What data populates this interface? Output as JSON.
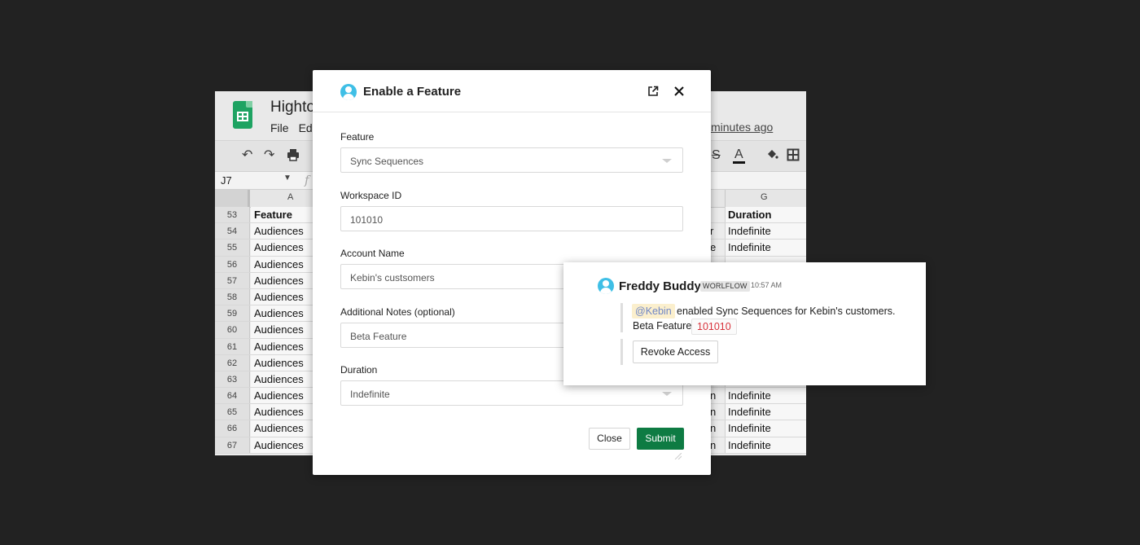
{
  "sheet": {
    "title": "Highto",
    "menu": [
      "File",
      "Ed"
    ],
    "last_edit": "minutes ago",
    "cell_ref": "J7",
    "fx": "f",
    "col_a": "A",
    "col_g": "G",
    "header_row": {
      "num": "53",
      "a": "Feature",
      "g": "Duration"
    },
    "rows": [
      {
        "num": "54",
        "a": "Audiences",
        "f": "r",
        "g": "Indefinite"
      },
      {
        "num": "55",
        "a": "Audiences",
        "f": "e",
        "g": "Indefinite"
      },
      {
        "num": "56",
        "a": "Audiences",
        "f": "",
        "g": ""
      },
      {
        "num": "57",
        "a": "Audiences",
        "f": "",
        "g": ""
      },
      {
        "num": "58",
        "a": "Audiences",
        "f": "",
        "g": ""
      },
      {
        "num": "59",
        "a": "Audiences",
        "f": "",
        "g": ""
      },
      {
        "num": "60",
        "a": "Audiences",
        "f": "",
        "g": ""
      },
      {
        "num": "61",
        "a": "Audiences",
        "f": "",
        "g": ""
      },
      {
        "num": "62",
        "a": "Audiences",
        "f": "",
        "g": ""
      },
      {
        "num": "63",
        "a": "Audiences",
        "f": "",
        "g": ""
      },
      {
        "num": "64",
        "a": "Audiences",
        "f": "n",
        "g": "Indefinite"
      },
      {
        "num": "65",
        "a": "Audiences",
        "f": "n",
        "g": "Indefinite"
      },
      {
        "num": "66",
        "a": "Audiences",
        "f": "n",
        "g": "Indefinite"
      },
      {
        "num": "67",
        "a": "Audiences",
        "f": "n",
        "g": "Indefinite"
      }
    ]
  },
  "modal": {
    "title": "Enable a Feature",
    "fields": {
      "feature": {
        "label": "Feature",
        "value": "Sync Sequences"
      },
      "workspace": {
        "label": "Workspace ID",
        "value": "101010"
      },
      "account": {
        "label": "Account Name",
        "value": "Kebin's custsomers"
      },
      "notes": {
        "label": "Additional Notes (optional)",
        "value": "Beta Feature"
      },
      "duration": {
        "label": "Duration",
        "value": "Indefinite"
      }
    },
    "close_label": "Close",
    "submit_label": "Submit"
  },
  "chat": {
    "name": "Freddy Buddy",
    "badge": "WORLFLOW",
    "time": "10:57 AM",
    "mention": "@Kebin",
    "message": "enabled Sync Sequences for Kebin's customers.",
    "line2": "Beta Feature",
    "id_chip": "101010",
    "revoke_label": "Revoke Access"
  },
  "colors": {
    "background": "#222222",
    "submit": "#0e7b43",
    "avatar": "#3fbfe6",
    "sheets_green": "#1ea362",
    "chip_red": "#d8323b",
    "mention_bg": "#fbefcd"
  }
}
